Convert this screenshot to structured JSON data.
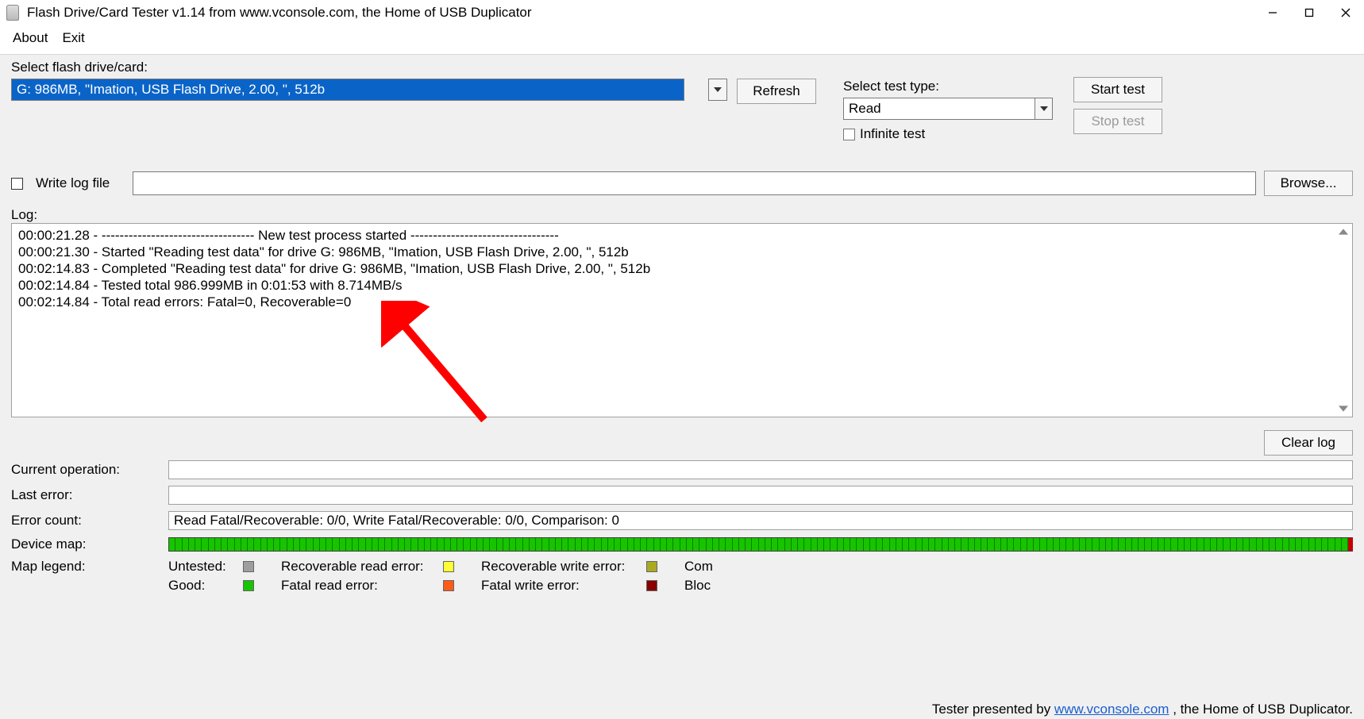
{
  "titlebar": {
    "title": "Flash Drive/Card Tester v1.14 from www.vconsole.com, the Home of USB Duplicator"
  },
  "menubar": {
    "about": "About",
    "exit": "Exit"
  },
  "select_drive": {
    "label": "Select flash drive/card:",
    "selected": "G: 986MB, \"Imation, USB Flash Drive, 2.00, \", 512b",
    "refresh": "Refresh"
  },
  "test_type": {
    "label": "Select test type:",
    "selected": "Read",
    "infinite": "Infinite test",
    "start": "Start test",
    "stop": "Stop test"
  },
  "logfile": {
    "write": "Write log file",
    "browse": "Browse..."
  },
  "log": {
    "label": "Log:",
    "lines": [
      "00:00:21.28 - ---------------------------------- New test process started ---------------------------------",
      "00:00:21.30 - Started \"Reading test data\" for drive G: 986MB, \"Imation, USB Flash Drive, 2.00, \", 512b",
      "00:02:14.83 - Completed \"Reading test data\" for drive G: 986MB, \"Imation, USB Flash Drive, 2.00, \", 512b",
      "00:02:14.84 - Tested total 986.999MB in 0:01:53 with  8.714MB/s",
      "00:02:14.84 - Total read errors: Fatal=0, Recoverable=0"
    ],
    "clear": "Clear log"
  },
  "status": {
    "current_op_label": "Current operation:",
    "current_op": "",
    "last_err_label": "Last error:",
    "last_err": "",
    "error_count_label": "Error count:",
    "error_count": "Read Fatal/Recoverable: 0/0, Write Fatal/Recoverable: 0/0, Comparison: 0",
    "device_map_label": "Device map:",
    "legend_label": "Map legend:"
  },
  "legend": {
    "untested": "Untested:",
    "good": "Good:",
    "rec_read": "Recoverable read error:",
    "fatal_read": "Fatal read error:",
    "rec_write": "Recoverable write error:",
    "fatal_write": "Fatal write error:",
    "comp": "Com",
    "block": "Bloc"
  },
  "colors": {
    "untested": "#9e9e9e",
    "good": "#17c400",
    "rec_read": "#ffff33",
    "fatal_read": "#ff5a1a",
    "rec_write": "#aaaa22",
    "fatal_write": "#880000"
  },
  "footer": {
    "prefix": "Tester presented by ",
    "link": "www.vconsole.com",
    "suffix": " , the Home of USB Duplicator."
  }
}
